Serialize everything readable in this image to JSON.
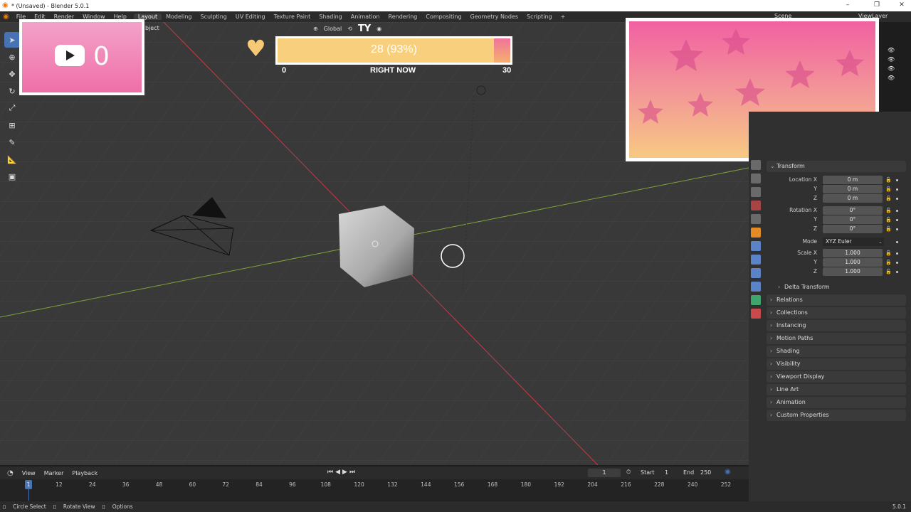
{
  "window": {
    "title": "* (Unsaved) - Blender 5.0.1",
    "minimize": "–",
    "maximize": "❐",
    "close": "✕"
  },
  "menu": {
    "items": [
      "File",
      "Edit",
      "Render",
      "Window",
      "Help"
    ],
    "workspaces": [
      "Layout",
      "Modeling",
      "Sculpting",
      "UV Editing",
      "Texture Paint",
      "Shading",
      "Animation",
      "Rendering",
      "Compositing",
      "Geometry Nodes",
      "Scripting"
    ],
    "add": "+",
    "scene_label": "Scene",
    "viewlayer_label": "ViewLayer"
  },
  "viewport_header": {
    "mode_suffix": "bject",
    "orientation": "Global",
    "overlay_text": "TY"
  },
  "overlays": {
    "yt_count": "0",
    "goal_text": "28 (93%)",
    "goal_progress": 0.93,
    "goal_min": "0",
    "goal_label": "RIGHT NOW",
    "goal_max": "30"
  },
  "properties": {
    "sections_top": {
      "transform": "Transform"
    },
    "location_label": "Location X",
    "rotation_label": "Rotation X",
    "y": "Y",
    "z": "Z",
    "loc": [
      "0 m",
      "0 m",
      "0 m"
    ],
    "rot": [
      "0°",
      "0°",
      "0°"
    ],
    "mode_label": "Mode",
    "mode_value": "XYZ Euler",
    "scale_label": "Scale X",
    "scale": [
      "1.000",
      "1.000",
      "1.000"
    ],
    "delta": "Delta Transform",
    "sections": [
      "Relations",
      "Collections",
      "Instancing",
      "Motion Paths",
      "Shading",
      "Visibility",
      "Viewport Display",
      "Line Art",
      "Animation",
      "Custom Properties"
    ]
  },
  "timeline": {
    "view": "View",
    "marker": "Marker",
    "playback": "Playback",
    "current_frame": "1",
    "start_label": "Start",
    "start": "1",
    "end_label": "End",
    "end": "250",
    "ticks": [
      "1",
      "12",
      "24",
      "36",
      "48",
      "60",
      "72",
      "84",
      "96",
      "108",
      "120",
      "132",
      "144",
      "156",
      "168",
      "180",
      "192",
      "204",
      "216",
      "228",
      "240",
      "252"
    ]
  },
  "status": {
    "select": "Circle Select",
    "rotate": "Rotate View",
    "options": "Options",
    "version": "5.0.1"
  },
  "colors": {
    "accent": "#4772b3",
    "x_axis": "#c53a46",
    "y_axis": "#7ea33a"
  }
}
